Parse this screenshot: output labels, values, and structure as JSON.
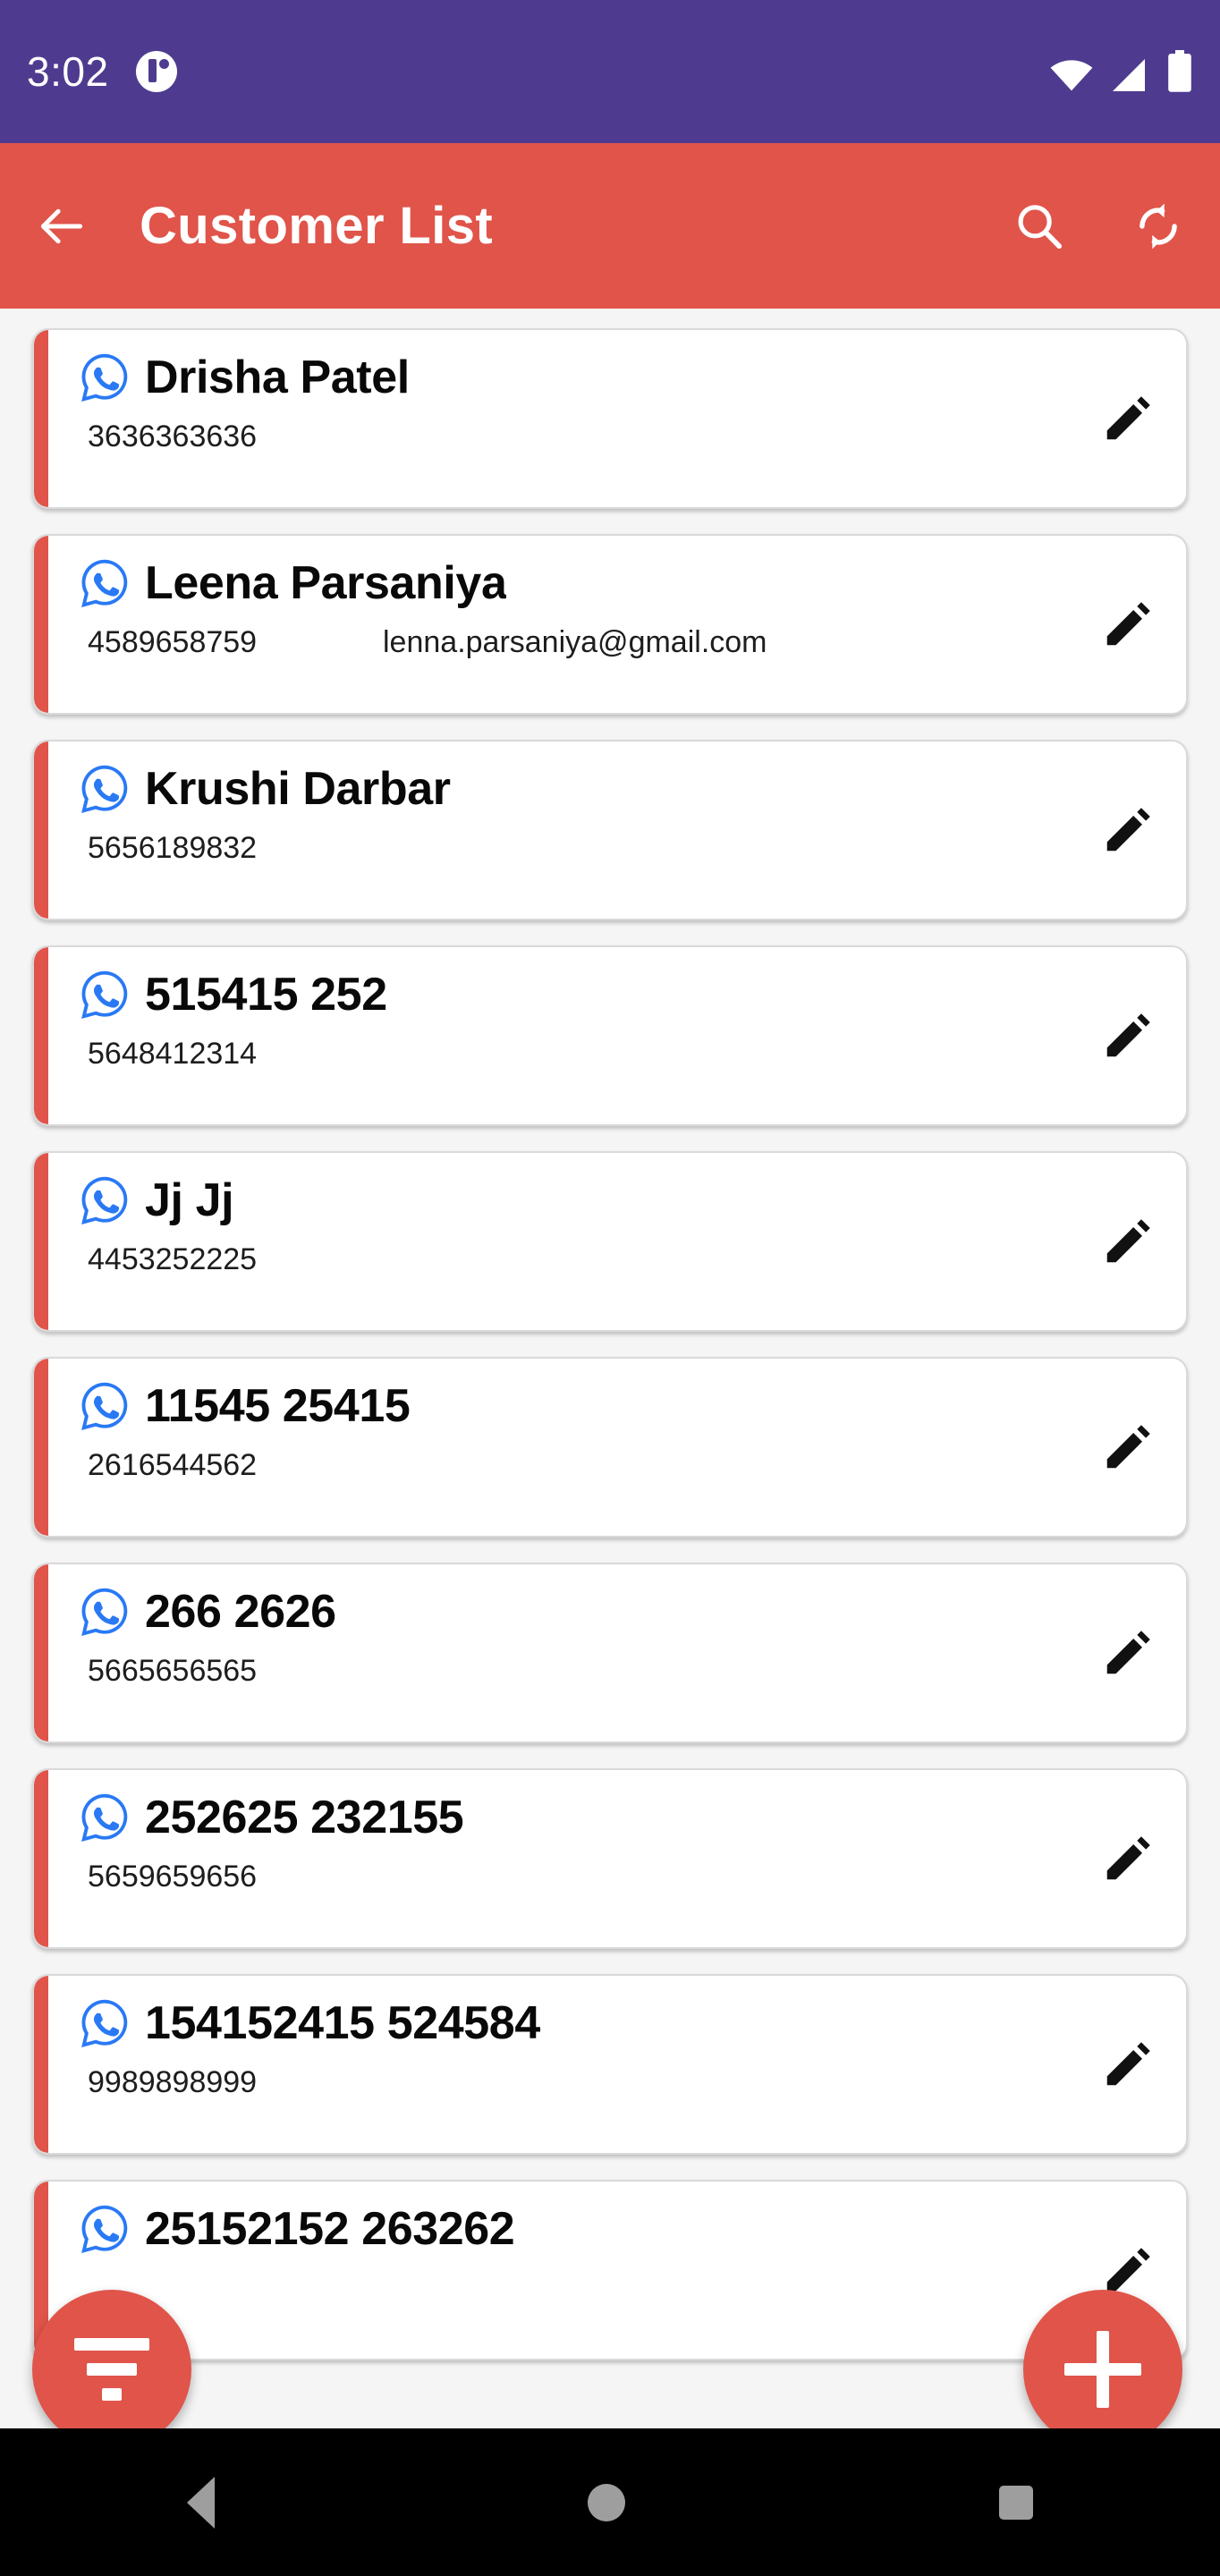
{
  "theme": {
    "status_bar_color": "#4e3b8f",
    "app_bar_color": "#e0544a",
    "accent_color": "#e0544a",
    "whatsapp_icon_color": "#2979f5",
    "page_background": "#f5f5f5",
    "nav_bar_color": "#000000"
  },
  "status_bar": {
    "time": "3:02",
    "notification_icon": "app-notification-icon",
    "wifi_icon": "wifi-icon",
    "signal_icon": "cellular-signal-icon",
    "battery_icon": "battery-icon"
  },
  "app_bar": {
    "back_icon": "back-arrow-icon",
    "title": "Customer List",
    "search_icon": "search-icon",
    "refresh_icon": "refresh-sync-icon"
  },
  "customers": [
    {
      "name": "Drisha Patel",
      "phone": "3636363636",
      "email": "",
      "whatsapp_icon": "whatsapp-icon",
      "edit_icon": "edit-pencil-icon"
    },
    {
      "name": "Leena Parsaniya",
      "phone": "4589658759",
      "email": "lenna.parsaniya@gmail.com",
      "whatsapp_icon": "whatsapp-icon",
      "edit_icon": "edit-pencil-icon"
    },
    {
      "name": "Krushi Darbar",
      "phone": "5656189832",
      "email": "",
      "whatsapp_icon": "whatsapp-icon",
      "edit_icon": "edit-pencil-icon"
    },
    {
      "name": "515415 252",
      "phone": "5648412314",
      "email": "",
      "whatsapp_icon": "whatsapp-icon",
      "edit_icon": "edit-pencil-icon"
    },
    {
      "name": "Jj Jj",
      "phone": "4453252225",
      "email": "",
      "whatsapp_icon": "whatsapp-icon",
      "edit_icon": "edit-pencil-icon"
    },
    {
      "name": "11545 25415",
      "phone": "2616544562",
      "email": "",
      "whatsapp_icon": "whatsapp-icon",
      "edit_icon": "edit-pencil-icon"
    },
    {
      "name": "266 2626",
      "phone": "5665656565",
      "email": "",
      "whatsapp_icon": "whatsapp-icon",
      "edit_icon": "edit-pencil-icon"
    },
    {
      "name": "252625 232155",
      "phone": "5659659656",
      "email": "",
      "whatsapp_icon": "whatsapp-icon",
      "edit_icon": "edit-pencil-icon"
    },
    {
      "name": "154152415 524584",
      "phone": "9989898999",
      "email": "",
      "whatsapp_icon": "whatsapp-icon",
      "edit_icon": "edit-pencil-icon"
    },
    {
      "name": "25152152 263262",
      "phone": "",
      "email": "",
      "whatsapp_icon": "whatsapp-icon",
      "edit_icon": "edit-pencil-icon"
    }
  ],
  "fabs": {
    "filter_icon": "filter-icon",
    "add_icon": "plus-icon"
  },
  "nav_bar": {
    "back_icon": "nav-back-icon",
    "home_icon": "nav-home-icon",
    "recents_icon": "nav-recents-icon"
  }
}
